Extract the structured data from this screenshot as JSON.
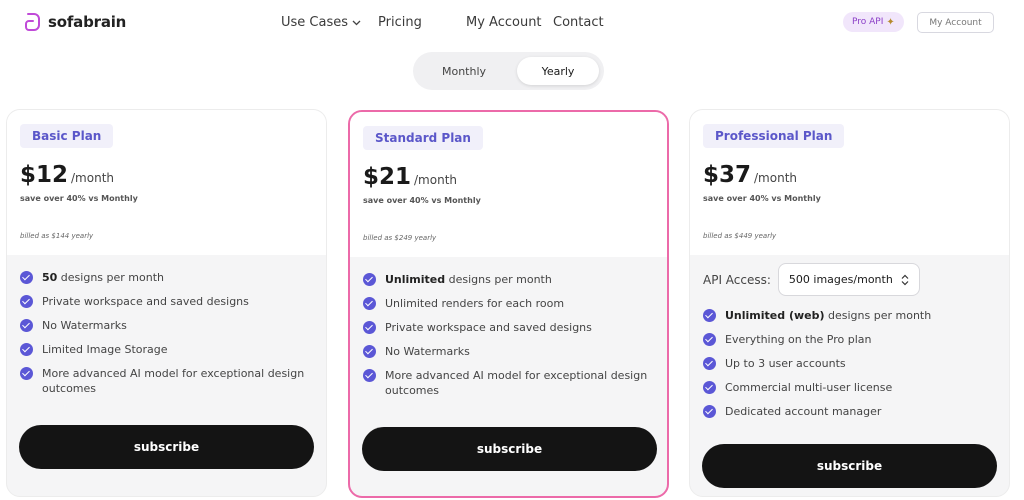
{
  "header": {
    "logo_text": "sofabrain",
    "nav": {
      "use_cases": "Use Cases",
      "pricing": "Pricing",
      "my_account": "My Account",
      "contact": "Contact"
    },
    "pro_api": "Pro API",
    "my_account_button": "My Account"
  },
  "billing_toggle": {
    "monthly": "Monthly",
    "yearly": "Yearly",
    "selected": "Yearly"
  },
  "plans": [
    {
      "name": "Basic Plan",
      "price": "$12",
      "unit": "/month",
      "save": "save over 40% vs Monthly",
      "billed": "billed as $144 yearly",
      "features": [
        {
          "bold": "50",
          "text": " designs per month"
        },
        {
          "bold": "",
          "text": "Private workspace and saved designs"
        },
        {
          "bold": "",
          "text": "No Watermarks"
        },
        {
          "bold": "",
          "text": "Limited Image Storage"
        },
        {
          "bold": "",
          "text": "More advanced AI model for exceptional design outcomes"
        }
      ],
      "cta": "subscribe"
    },
    {
      "name": "Standard Plan",
      "price": "$21",
      "unit": "/month",
      "save": "save over 40% vs Monthly",
      "billed": "billed as $249 yearly",
      "features": [
        {
          "bold": "Unlimited",
          "text": " designs per month"
        },
        {
          "bold": "",
          "text": "Unlimited renders for each room"
        },
        {
          "bold": "",
          "text": "Private workspace and saved designs"
        },
        {
          "bold": "",
          "text": "No Watermarks"
        },
        {
          "bold": "",
          "text": "More advanced AI model for exceptional design outcomes"
        }
      ],
      "cta": "subscribe"
    },
    {
      "name": "Professional Plan",
      "price": "$37",
      "unit": "/month",
      "save": "save over 40% vs Monthly",
      "billed": "billed as $449 yearly",
      "api_label": "API Access:",
      "api_value": "500 images/month",
      "features": [
        {
          "bold": "Unlimited (web)",
          "text": " designs per month"
        },
        {
          "bold": "",
          "text": "Everything on the Pro plan"
        },
        {
          "bold": "",
          "text": "Up to 3 user accounts"
        },
        {
          "bold": "",
          "text": "Commercial multi-user license"
        },
        {
          "bold": "",
          "text": "Dedicated account manager"
        }
      ],
      "cta": "subscribe"
    }
  ],
  "colors": {
    "accent": "#5b57d6",
    "highlight_border": "#ec6aa9",
    "button": "#141414"
  }
}
